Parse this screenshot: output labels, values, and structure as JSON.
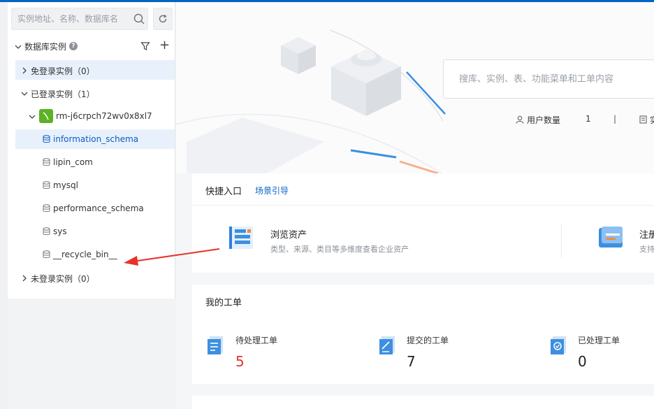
{
  "sidebar": {
    "search_placeholder": "实例地址、名称、数据库名",
    "tree_title": "数据库实例",
    "groups": [
      {
        "label": "免登录实例",
        "count": "（0）"
      },
      {
        "label": "已登录实例",
        "count": "（1）"
      },
      {
        "label": "未登录实例",
        "count": "（0）"
      }
    ],
    "instance_name": "rm-j6crpch72wv0x8xl7",
    "databases": [
      "information_schema",
      "lipin_com",
      "mysql",
      "performance_schema",
      "sys",
      "__recycle_bin__"
    ]
  },
  "main": {
    "search_placeholder": "搜库、实例、表、功能菜单和工单内容",
    "user_count_label": "用户数量",
    "user_count_value": "1",
    "stat_sep": "|",
    "stat_next_partial": "实",
    "quick": {
      "title": "快捷入口",
      "link": "场景引导",
      "items": [
        {
          "title": "浏览资产",
          "desc": "类型、来源、类目等多维度查看企业资产"
        },
        {
          "title": "注册",
          "desc": "支持"
        }
      ]
    },
    "workorders": {
      "title": "我的工单",
      "items": [
        {
          "label": "待处理工单",
          "count": "5"
        },
        {
          "label": "提交的工单",
          "count": "7"
        },
        {
          "label": "已处理工单",
          "count": "0"
        }
      ]
    }
  },
  "colors": {
    "accent": "#0a64c8",
    "pending": "#e0362c",
    "mysql": "#5bb224",
    "annotation_arrow": "#e8312b"
  }
}
